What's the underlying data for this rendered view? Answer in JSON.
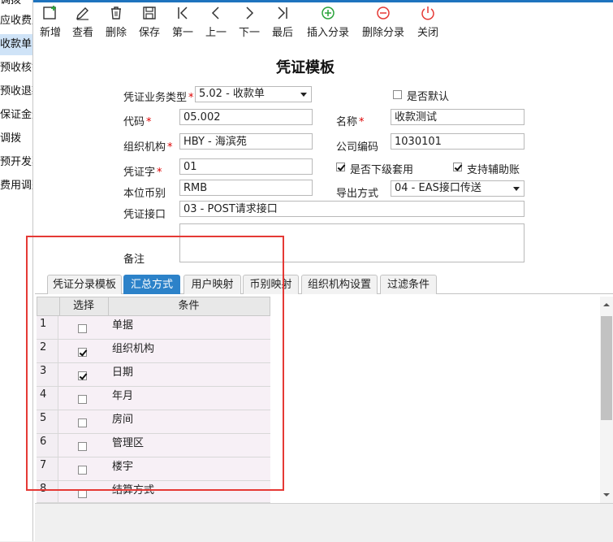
{
  "left_panel": {
    "items": [
      "应收费用",
      "收款单",
      "预收核销",
      "预收退款",
      "保证金退",
      "调拨",
      "预开发票",
      "费用调整"
    ],
    "selected_index": 1,
    "top_partial": "调拨"
  },
  "toolbar": {
    "buttons": [
      {
        "label": "新增",
        "icon": "add-icon"
      },
      {
        "label": "查看",
        "icon": "edit-icon"
      },
      {
        "label": "删除",
        "icon": "trash-icon"
      },
      {
        "label": "保存",
        "icon": "save-icon"
      },
      {
        "label": "第一",
        "icon": "first-icon"
      },
      {
        "label": "上一",
        "icon": "prev-icon"
      },
      {
        "label": "下一",
        "icon": "next-icon"
      },
      {
        "label": "最后",
        "icon": "last-icon"
      },
      {
        "label": "插入分录",
        "icon": "plus-circle-icon"
      },
      {
        "label": "删除分录",
        "icon": "minus-circle-icon"
      },
      {
        "label": "关闭",
        "icon": "power-icon"
      }
    ],
    "colors": {
      "insert": "#2aa33a",
      "delete": "#e53935",
      "close": "#e53935"
    }
  },
  "page_title": "凭证模板",
  "form": {
    "business_type_label": "凭证业务类型",
    "business_type_value": "5.02 - 收款单",
    "is_default_label": "是否默认",
    "is_default_checked": false,
    "code_label": "代码",
    "code_value": "05.002",
    "name_label": "名称",
    "name_value": "收款测试",
    "org_label": "组织机构",
    "org_value": "HBY - 海滨苑",
    "company_code_label": "公司编码",
    "company_code_value": "1030101",
    "voucher_word_label": "凭证字",
    "voucher_word_value": "01",
    "sub_apply_label": "是否下级套用",
    "sub_apply_checked": true,
    "aux_account_label": "支持辅助账",
    "aux_account_checked": true,
    "currency_label": "本位币别",
    "currency_value": "RMB",
    "export_label": "导出方式",
    "export_value": "04 - EAS接口传送",
    "api_label": "凭证接口",
    "api_value": "03 - POST请求接口",
    "remark_label": "备注",
    "remark_value": ""
  },
  "tabs": [
    {
      "label": "凭证分录模板",
      "active": false
    },
    {
      "label": "汇总方式",
      "active": true
    },
    {
      "label": "用户映射",
      "active": false
    },
    {
      "label": "币别映射",
      "active": false
    },
    {
      "label": "组织机构设置",
      "active": false
    },
    {
      "label": "过滤条件",
      "active": false
    }
  ],
  "grid": {
    "headers": [
      "选择",
      "条件"
    ],
    "rows": [
      {
        "num": "1",
        "checked": false,
        "cond": "单据"
      },
      {
        "num": "2",
        "checked": true,
        "cond": "组织机构"
      },
      {
        "num": "3",
        "checked": true,
        "cond": "日期"
      },
      {
        "num": "4",
        "checked": false,
        "cond": "年月"
      },
      {
        "num": "5",
        "checked": false,
        "cond": "房间"
      },
      {
        "num": "6",
        "checked": false,
        "cond": "管理区"
      },
      {
        "num": "7",
        "checked": false,
        "cond": "楼宇"
      },
      {
        "num": "8",
        "checked": false,
        "cond": "结算方式"
      }
    ]
  },
  "highlight_color": "#e53935"
}
